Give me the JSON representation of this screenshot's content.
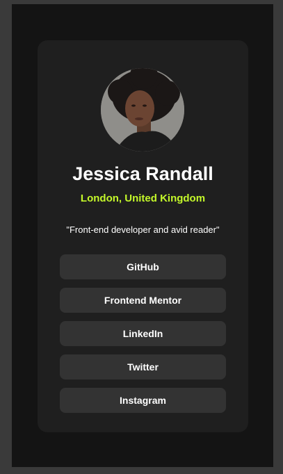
{
  "profile": {
    "name": "Jessica Randall",
    "location": "London, United Kingdom",
    "bio": "\"Front-end developer and avid reader\""
  },
  "links": [
    {
      "label": "GitHub"
    },
    {
      "label": "Frontend Mentor"
    },
    {
      "label": "LinkedIn"
    },
    {
      "label": "Twitter"
    },
    {
      "label": "Instagram"
    }
  ],
  "colors": {
    "page_background": "#3a3a3a",
    "frame_background": "#141414",
    "card_background": "#1f1f1f",
    "button_background": "#333333",
    "accent": "#c4f82a",
    "text": "#ffffff"
  }
}
